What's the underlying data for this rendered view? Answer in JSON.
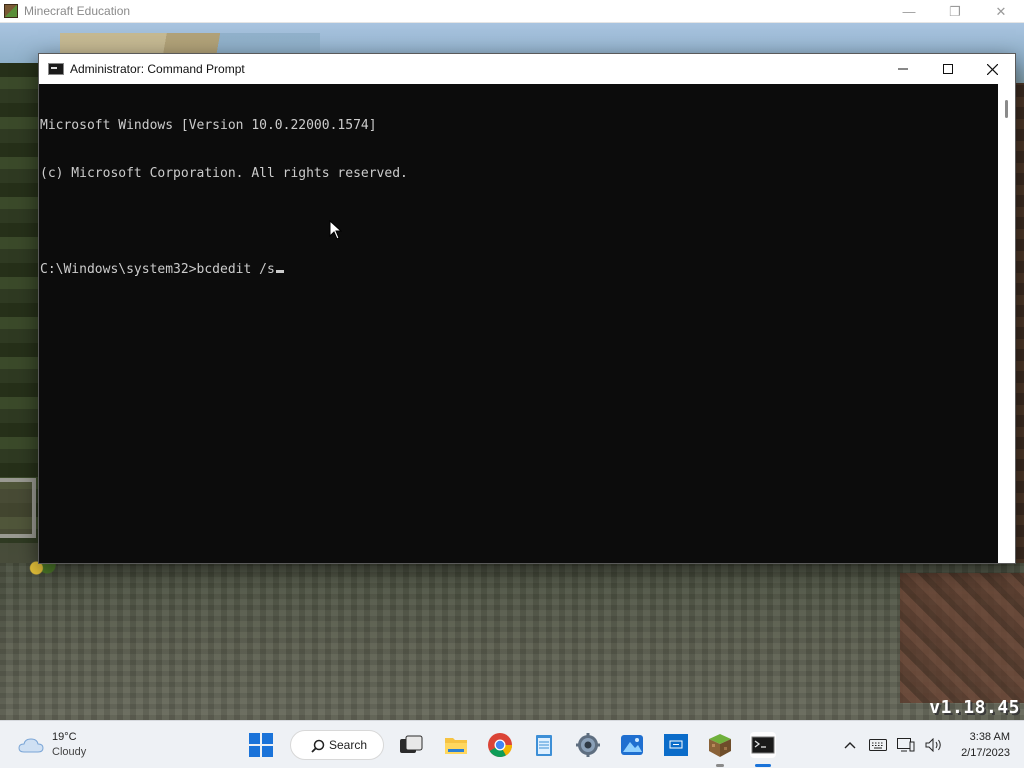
{
  "app_window": {
    "title": "Minecraft Education",
    "controls": {
      "minimize": "—",
      "restore": "❐",
      "close": "✕"
    }
  },
  "game": {
    "version": "v1.18.45"
  },
  "cmd": {
    "title": "Administrator:  Command Prompt",
    "lines": [
      "Microsoft Windows [Version 10.0.22000.1574]",
      "(c) Microsoft Corporation. All rights reserved.",
      "",
      "C:\\Windows\\system32>bcdedit /s"
    ],
    "colors": {
      "background": "#0c0c0c",
      "text": "#cccccc"
    }
  },
  "taskbar": {
    "weather": {
      "temperature": "19°C",
      "condition": "Cloudy"
    },
    "search_label": "Search",
    "pinned": [
      "start-icon",
      "search-icon",
      "task-view-icon",
      "file-explorer-icon",
      "chrome-icon",
      "notepad-icon",
      "settings-icon",
      "photos-icon",
      "remote-desktop-icon",
      "minecraft-icon",
      "command-prompt-icon"
    ],
    "tray": [
      "chevron-up-icon",
      "keyboard-icon",
      "display-network-icon",
      "volume-icon"
    ],
    "clock": {
      "time": "3:38 AM",
      "date": "2/17/2023"
    },
    "accent": "#1a73d9"
  }
}
